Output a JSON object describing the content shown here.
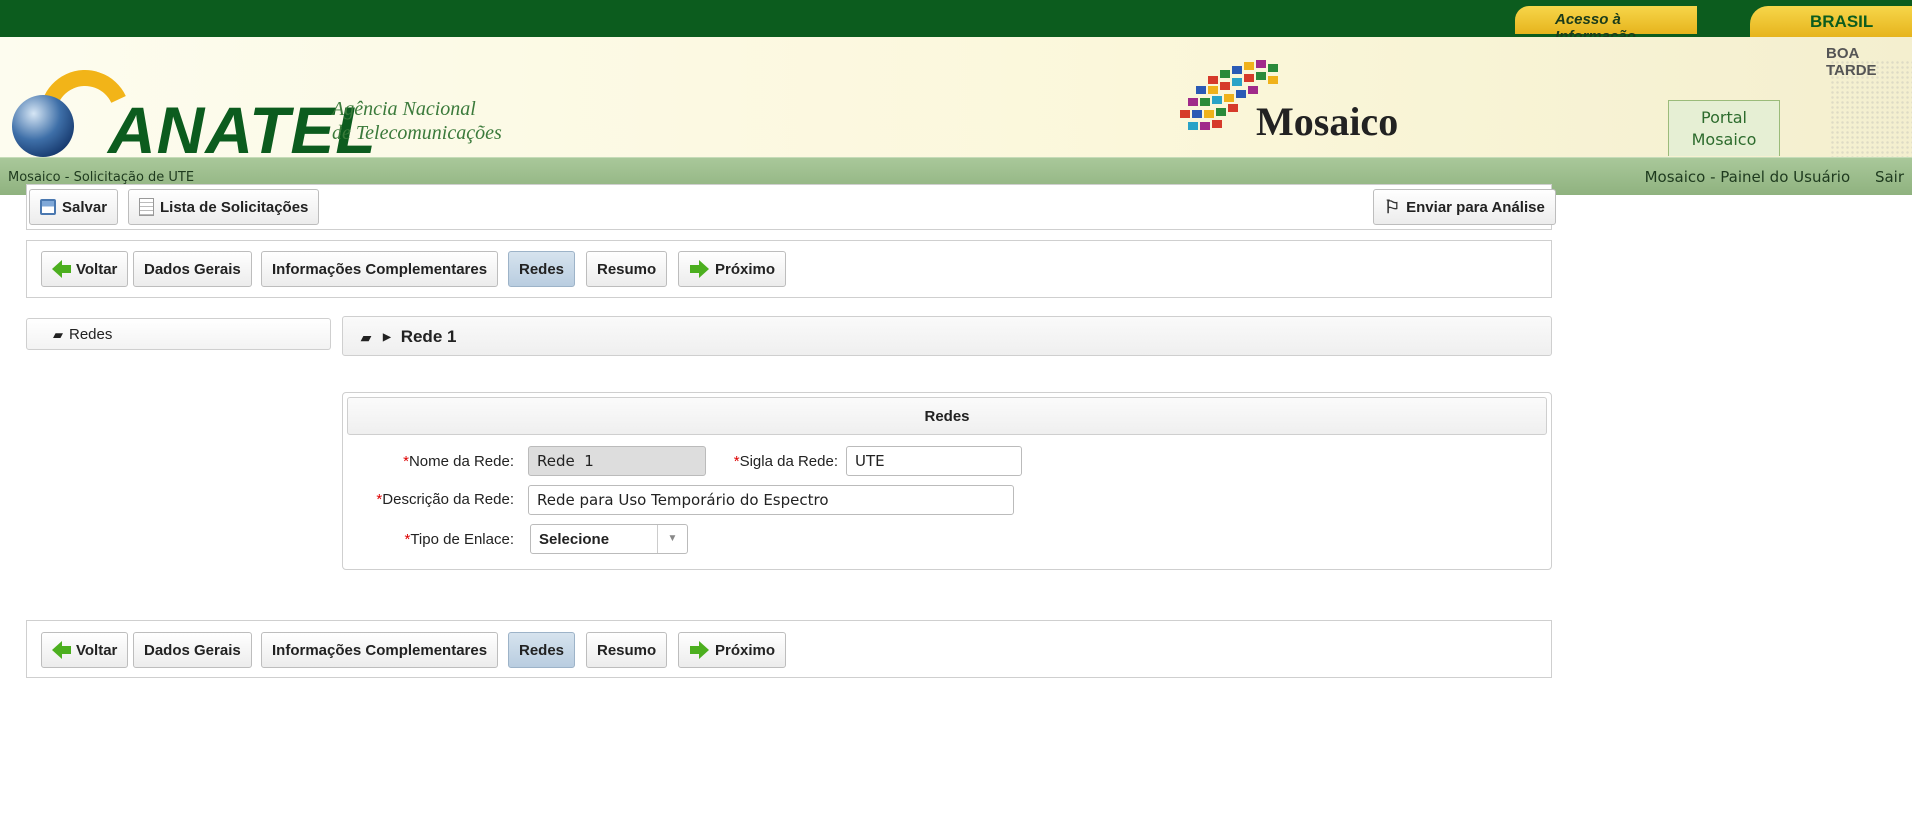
{
  "govbar": {
    "acesso": "Acesso à Informação",
    "brasil": "BRASIL"
  },
  "header": {
    "logo": "ANATEL",
    "agencia_line1": "Agência Nacional",
    "agencia_line2": "de Telecomunicações",
    "app_name": "Mosaico",
    "greeting": "BOA TARDE",
    "portal_line1": "Portal",
    "portal_line2": "Mosaico"
  },
  "crumb": {
    "page": "Mosaico - Solicitação de UTE",
    "painel": "Mosaico - Painel do Usuário",
    "sair": "Sair"
  },
  "toolbar": {
    "salvar": "Salvar",
    "lista": "Lista de Solicitações",
    "enviar": "Enviar para Análise"
  },
  "steps": {
    "voltar": "Voltar",
    "dados": "Dados Gerais",
    "info": "Informações Complementares",
    "redes": "Redes",
    "resumo": "Resumo",
    "proximo": "Próximo"
  },
  "tree": {
    "root": "Redes"
  },
  "netbar": {
    "title": "Rede 1"
  },
  "form": {
    "title": "Redes",
    "nome_label": "Nome da Rede:",
    "nome_value": "Rede  1",
    "sigla_label": "Sigla da Rede:",
    "sigla_value": "UTE",
    "descricao_label": "Descrição da Rede:",
    "descricao_value": "Rede para Uso Temporário do Espectro",
    "tipo_label": "Tipo de Enlace:",
    "tipo_value": "Selecione",
    "required_mark": "*"
  },
  "colors": {
    "gov_green": "#0c5c1e",
    "gold": "#f2b418",
    "active_tab": "#c4d6e8",
    "required": "#dd0000"
  }
}
